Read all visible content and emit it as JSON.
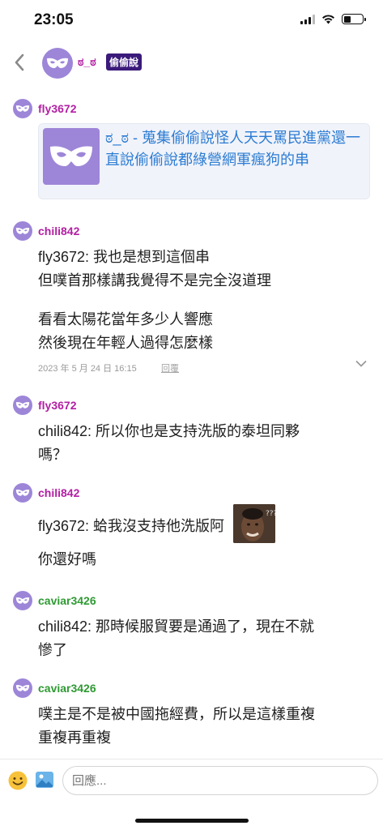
{
  "status_bar": {
    "time": "23:05",
    "battery_level": 0.4
  },
  "header": {
    "board_name": "ಠ_ಠ",
    "board_badge": "偷偷說",
    "icons": {
      "back": "chevron-left-icon",
      "avatar": "mask-icon"
    }
  },
  "colors": {
    "author_purple": "#b31fa3",
    "author_green": "#2f9a33",
    "avatar_bg": "#9d86d8",
    "link": "#2b7cd3",
    "badge_bg": "#3a1a7a"
  },
  "messages": [
    {
      "author": "fly3672",
      "link_card": {
        "text": "ಠ_ಠ - 蒐集偷偷說怪人天天罵民進黨還一直說偷偷說都綠營網軍瘋狗的串"
      }
    },
    {
      "author": "chili842",
      "lines": [
        "fly3672: 我也是想到這個串",
        "但噗首那樣講我覺得不是完全沒道理",
        "",
        "看看太陽花當年多少人響應",
        "然後現在年輕人過得怎麼樣"
      ],
      "meta": {
        "date": "2023 年 5 月 24 日 16:15",
        "reply": "回覆"
      }
    },
    {
      "author": "fly3672",
      "lines": [
        "chili842: 所以你也是支持洗版的泰坦同夥",
        "嗎？"
      ]
    },
    {
      "author": "chili842",
      "lines": [
        "fly3672: 蛤我沒支持他洗版阿",
        "",
        "你還好嗎"
      ],
      "sticker": "confused-face-sticker"
    },
    {
      "author": "caviar3426",
      "lines": [
        "chili842: 那時候服貿要是通過了，現在不就",
        "慘了"
      ]
    },
    {
      "author": "caviar3426",
      "lines": [
        "噗主是不是被中國拖經費，所以是這樣重複",
        "重複再重複"
      ]
    }
  ],
  "compose": {
    "placeholder": "回應..."
  }
}
